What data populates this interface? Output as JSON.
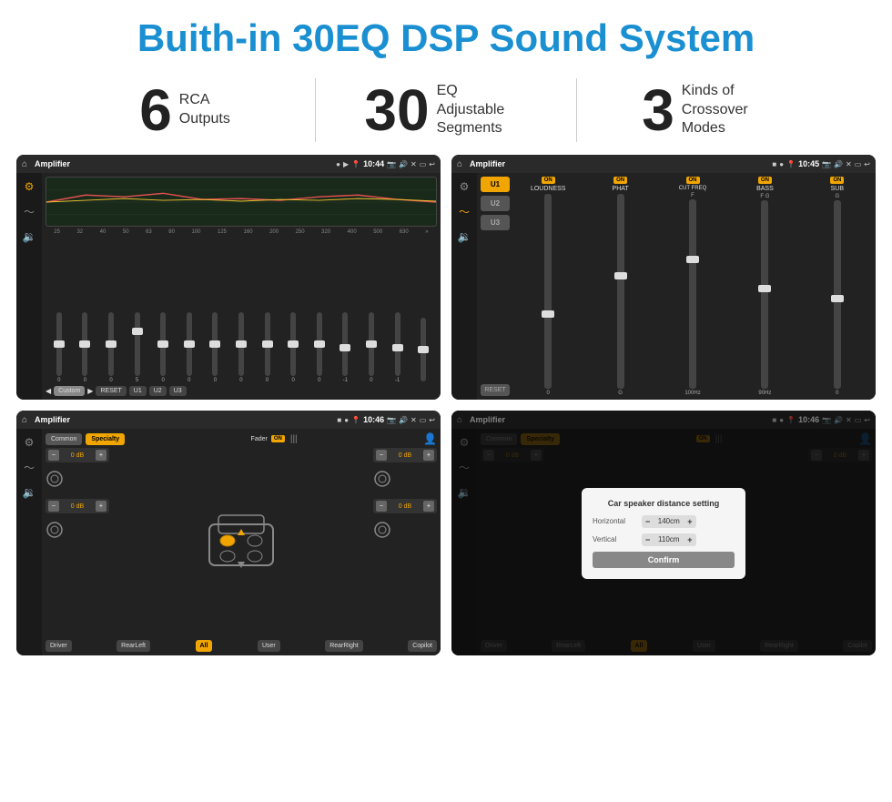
{
  "header": {
    "title": "Buith-in 30EQ DSP Sound System"
  },
  "stats": [
    {
      "number": "6",
      "text": "RCA\nOutputs"
    },
    {
      "number": "30",
      "text": "EQ Adjustable\nSegments"
    },
    {
      "number": "3",
      "text": "Kinds of\nCrossover Modes"
    }
  ],
  "screens": [
    {
      "id": "eq-screen",
      "statusBar": {
        "title": "Amplifier",
        "time": "10:44"
      },
      "type": "eq"
    },
    {
      "id": "crossover-screen",
      "statusBar": {
        "title": "Amplifier",
        "time": "10:45"
      },
      "type": "crossover"
    },
    {
      "id": "fader-screen",
      "statusBar": {
        "title": "Amplifier",
        "time": "10:46"
      },
      "type": "fader"
    },
    {
      "id": "distance-screen",
      "statusBar": {
        "title": "Amplifier",
        "time": "10:46"
      },
      "type": "distance"
    }
  ],
  "eq": {
    "frequencies": [
      "25",
      "32",
      "40",
      "50",
      "63",
      "80",
      "100",
      "125",
      "160",
      "200",
      "250",
      "320",
      "400",
      "500",
      "630"
    ],
    "values": [
      "0",
      "0",
      "0",
      "5",
      "0",
      "0",
      "0",
      "0",
      "0",
      "0",
      "0",
      "-1",
      "0",
      "-1",
      ""
    ],
    "presets": [
      "Custom",
      "RESET",
      "U1",
      "U2",
      "U3"
    ]
  },
  "crossover": {
    "uButtons": [
      "U1",
      "U2",
      "U3"
    ],
    "channels": [
      {
        "label": "LOUDNESS",
        "on": true
      },
      {
        "label": "PHAT",
        "on": true
      },
      {
        "label": "CUT FREQ",
        "on": true
      },
      {
        "label": "BASS",
        "on": true
      },
      {
        "label": "SUB",
        "on": true
      }
    ]
  },
  "fader": {
    "tabs": [
      "Common",
      "Specialty"
    ],
    "faderLabel": "Fader",
    "faderOn": "ON",
    "dbValues": [
      "0 dB",
      "0 dB",
      "0 dB",
      "0 dB"
    ],
    "buttons": [
      "Driver",
      "RearLeft",
      "All",
      "User",
      "RearRight",
      "Copilot"
    ]
  },
  "distance": {
    "title": "Car speaker distance setting",
    "horizontal": {
      "label": "Horizontal",
      "value": "140cm"
    },
    "vertical": {
      "label": "Vertical",
      "value": "110cm"
    },
    "confirmLabel": "Confirm",
    "tabs": [
      "Common",
      "Specialty"
    ],
    "dbValues": [
      "0 dB",
      "0 dB"
    ],
    "buttons": [
      "Driver",
      "RearLeft",
      "All",
      "User",
      "RearRight",
      "Copilot"
    ]
  }
}
